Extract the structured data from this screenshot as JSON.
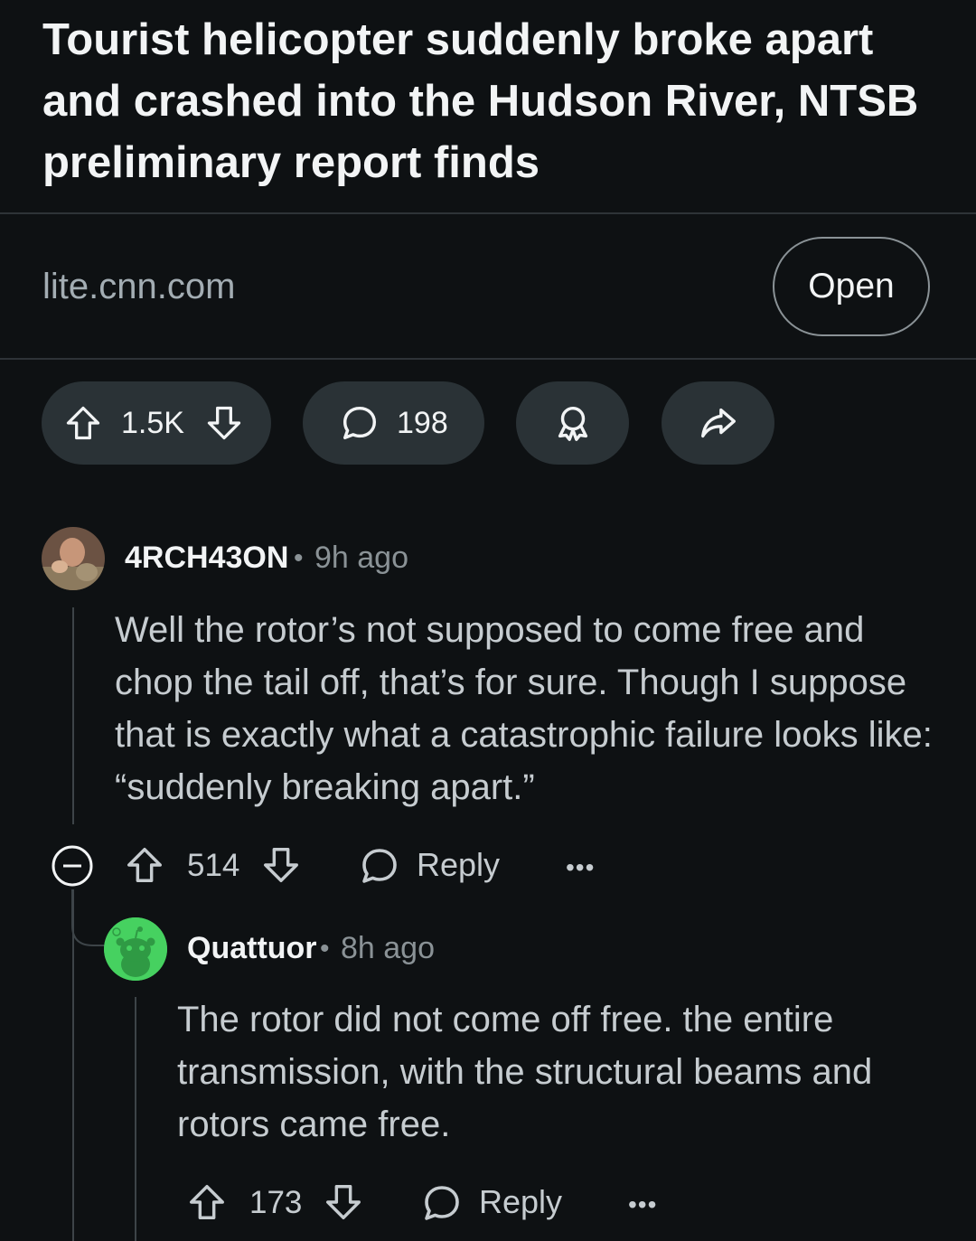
{
  "post": {
    "title": "Tourist helicopter suddenly broke apart and crashed into the Hudson River, NTSB preliminary report finds",
    "link_domain": "lite.cnn.com",
    "open_label": "Open",
    "score": "1.5K",
    "comment_count": "198"
  },
  "comments": [
    {
      "username": "4RCH43ON",
      "separator": "•",
      "time": "9h ago",
      "body": "Well the rotor’s not supposed to come free and chop the tail off, that’s for sure.  Though I suppose that is exactly what a catastrophic failure looks like: “suddenly breaking apart.”",
      "score": "514",
      "reply_label": "Reply",
      "more_label": "•••"
    },
    {
      "username": "Quattuor",
      "separator": "•",
      "time": "8h ago",
      "body": "The rotor did not come off free. the entire transmission, with the structural beams and rotors came free.",
      "score": "173",
      "reply_label": "Reply",
      "more_label": "•••"
    }
  ],
  "icons": {
    "upvote": "upvote-arrow-icon",
    "downvote": "downvote-arrow-icon",
    "comment": "comment-bubble-icon",
    "award": "award-icon",
    "share": "share-arrow-icon",
    "collapse": "collapse-minus-icon"
  },
  "colors": {
    "background": "#0e1113",
    "pill": "#2a3236",
    "text": "#f2f4f5",
    "muted": "#8a9296",
    "snoo_green": "#46d160"
  }
}
